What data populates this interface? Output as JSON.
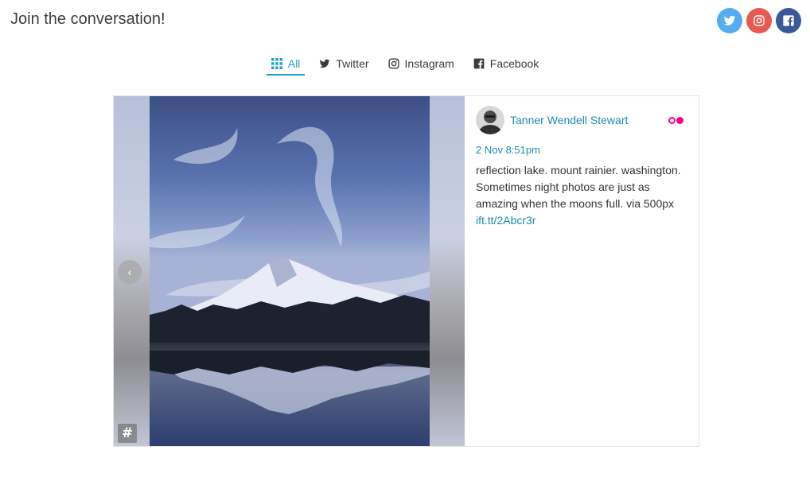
{
  "header": {
    "title": "Join the conversation!"
  },
  "social": [
    {
      "name": "twitter",
      "icon": "twitter-icon",
      "color": "#55acee"
    },
    {
      "name": "instagram",
      "icon": "instagram-icon",
      "color": "#e95950"
    },
    {
      "name": "facebook",
      "icon": "facebook-icon",
      "color": "#3b5998"
    }
  ],
  "tabs": [
    {
      "label": "All",
      "icon": "grid-icon",
      "active": true
    },
    {
      "label": "Twitter",
      "icon": "twitter-icon",
      "active": false
    },
    {
      "label": "Instagram",
      "icon": "instagram-icon",
      "active": false
    },
    {
      "label": "Facebook",
      "icon": "facebook-icon",
      "active": false
    }
  ],
  "post": {
    "author": "Tanner Wendell Stewart",
    "date": "2 Nov 8:51pm",
    "text": "reflection lake. mount rainier. washington. Sometimes night photos are just as amazing when the moons full. via 500px ",
    "link": "ift.tt/2Abcr3r",
    "source_icon": "flickr-icon",
    "image": "mountain-lake-night-photo"
  },
  "colors": {
    "accent": "#1fa2c6",
    "link": "#1d8bad",
    "flickr_pink": "#ff0084",
    "flickr_blue": "#0063dc"
  },
  "controls": {
    "prev_label": "‹",
    "next_label": "›",
    "hashtag_label": "#"
  }
}
